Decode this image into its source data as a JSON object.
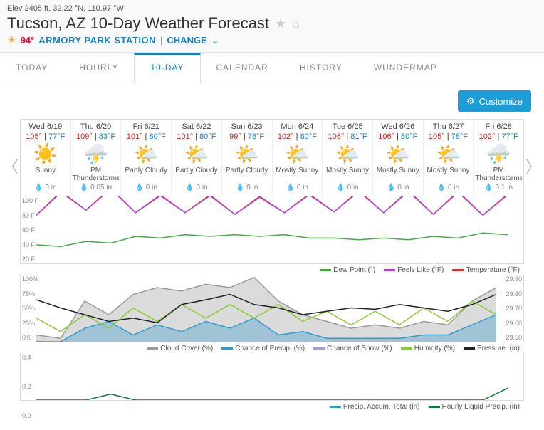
{
  "header": {
    "elev": "Elev 2405 ft, 32.22 °N, 110.97 °W",
    "title": "Tucson, AZ 10-Day Weather Forecast",
    "cur_temp": "94°",
    "station": "ARMORY PARK STATION",
    "divider": "|",
    "change": "CHANGE"
  },
  "tabs": {
    "today": "TODAY",
    "hourly": "HOURLY",
    "tenday": "10-DAY",
    "calendar": "CALENDAR",
    "history": "HISTORY",
    "wmap": "WUNDERMAP"
  },
  "customize": "Customize",
  "days": [
    {
      "date": "Wed 6/19",
      "hi": "105°",
      "lo": "77°F",
      "icon": "sun",
      "cond": "Sunny",
      "precip": "0 in"
    },
    {
      "date": "Thu 6/20",
      "hi": "109°",
      "lo": "83°F",
      "icon": "storm",
      "cond": "PM Thunderstorms",
      "precip": "0.05 in"
    },
    {
      "date": "Fri 6/21",
      "hi": "101°",
      "lo": "80°F",
      "icon": "partly",
      "cond": "Partly Cloudy",
      "precip": "0 in"
    },
    {
      "date": "Sat 6/22",
      "hi": "101°",
      "lo": "80°F",
      "icon": "partly",
      "cond": "Partly Cloudy",
      "precip": "0 in"
    },
    {
      "date": "Sun 6/23",
      "hi": "99°",
      "lo": "78°F",
      "icon": "partly",
      "cond": "Partly Cloudy",
      "precip": "0 in"
    },
    {
      "date": "Mon 6/24",
      "hi": "102°",
      "lo": "80°F",
      "icon": "mostly",
      "cond": "Mostly Sunny",
      "precip": "0 in"
    },
    {
      "date": "Tue 6/25",
      "hi": "106°",
      "lo": "81°F",
      "icon": "mostly",
      "cond": "Mostly Sunny",
      "precip": "0 in"
    },
    {
      "date": "Wed 6/26",
      "hi": "106°",
      "lo": "80°F",
      "icon": "mostly",
      "cond": "Mostly Sunny",
      "precip": "0 in"
    },
    {
      "date": "Thu 6/27",
      "hi": "105°",
      "lo": "78°F",
      "icon": "mostly",
      "cond": "Mostly Sunny",
      "precip": "0 in"
    },
    {
      "date": "Fri 6/28",
      "hi": "102°",
      "lo": "77°F",
      "icon": "storm",
      "cond": "PM Thunderstorms",
      "precip": "0.1 in"
    }
  ],
  "legends": {
    "c1": [
      {
        "c": "#4a4",
        "t": "Dew Point (°)"
      },
      {
        "c": "#a4d",
        "t": "Feels Like (°F)"
      },
      {
        "c": "#d33",
        "t": "Temperature (°F)"
      }
    ],
    "c2": [
      {
        "c": "#999",
        "t": "Cloud Cover (%)"
      },
      {
        "c": "#39c",
        "t": "Chance of Precip. (%)"
      },
      {
        "c": "#a9d",
        "t": "Chance of Snow (%)"
      },
      {
        "c": "#8c3",
        "t": "Humidity (%)"
      },
      {
        "c": "#222",
        "t": "Pressure. (in)"
      }
    ],
    "c3": [
      {
        "c": "#39c",
        "t": "Precip. Accum. Total (in)"
      },
      {
        "c": "#173",
        "t": "Hourly Liquid Precip. (in)"
      }
    ]
  },
  "chart_data": [
    {
      "type": "line",
      "ylim": [
        20,
        100
      ],
      "ylabel": "°F",
      "series": [
        {
          "name": "Temperature",
          "color": "#d33",
          "values": [
            77,
            105,
            83,
            109,
            80,
            101,
            80,
            101,
            78,
            99,
            80,
            102,
            81,
            106,
            80,
            106,
            78,
            105,
            77,
            102
          ]
        },
        {
          "name": "Feels Like",
          "color": "#a4d",
          "values": [
            77,
            104,
            83,
            108,
            80,
            100,
            80,
            100,
            78,
            98,
            80,
            101,
            81,
            105,
            80,
            105,
            78,
            104,
            77,
            101
          ]
        },
        {
          "name": "Dew Point",
          "color": "#4a4",
          "values": [
            42,
            40,
            46,
            44,
            52,
            50,
            54,
            52,
            54,
            52,
            54,
            50,
            50,
            48,
            50,
            48,
            52,
            50,
            56,
            54
          ]
        }
      ]
    },
    {
      "type": "line",
      "ylim": [
        0,
        100
      ],
      "ylabel": "%",
      "ylim_r": [
        29.5,
        29.9
      ],
      "series": [
        {
          "name": "Cloud Cover",
          "color": "#999",
          "area": true,
          "values": [
            10,
            5,
            60,
            40,
            70,
            80,
            75,
            85,
            80,
            95,
            60,
            40,
            30,
            20,
            25,
            20,
            30,
            25,
            60,
            80
          ]
        },
        {
          "name": "Chance of Precip",
          "color": "#39c",
          "area": true,
          "values": [
            0,
            0,
            20,
            30,
            10,
            25,
            15,
            30,
            20,
            35,
            10,
            15,
            5,
            5,
            5,
            5,
            10,
            10,
            25,
            40
          ]
        },
        {
          "name": "Humidity",
          "color": "#8c3",
          "values": [
            35,
            15,
            40,
            20,
            50,
            30,
            55,
            35,
            55,
            35,
            55,
            30,
            45,
            25,
            45,
            25,
            50,
            30,
            60,
            40
          ]
        },
        {
          "name": "Pressure",
          "color": "#222",
          "values": [
            62,
            50,
            40,
            30,
            35,
            28,
            55,
            62,
            70,
            55,
            50,
            40,
            45,
            50,
            48,
            55,
            50,
            45,
            55,
            70
          ]
        }
      ]
    },
    {
      "type": "line",
      "ylim": [
        0,
        0.4
      ],
      "ylabel": "in",
      "series": [
        {
          "name": "Hourly Liquid Precip",
          "color": "#173",
          "values": [
            0,
            0,
            0,
            0.05,
            0,
            0,
            0,
            0,
            0,
            0,
            0,
            0,
            0,
            0,
            0,
            0,
            0,
            0,
            0,
            0.1
          ]
        }
      ]
    }
  ],
  "axis": {
    "c1": [
      "100 F",
      "80 F",
      "60 F",
      "40 F",
      "20 F"
    ],
    "c2l": [
      "100%",
      "75%",
      "50%",
      "25%",
      "0%"
    ],
    "c2r": [
      "29.90",
      "29.80",
      "29.70",
      "29.60",
      "29.50"
    ],
    "c3": [
      "0.4",
      "0.2",
      "0.0"
    ]
  }
}
